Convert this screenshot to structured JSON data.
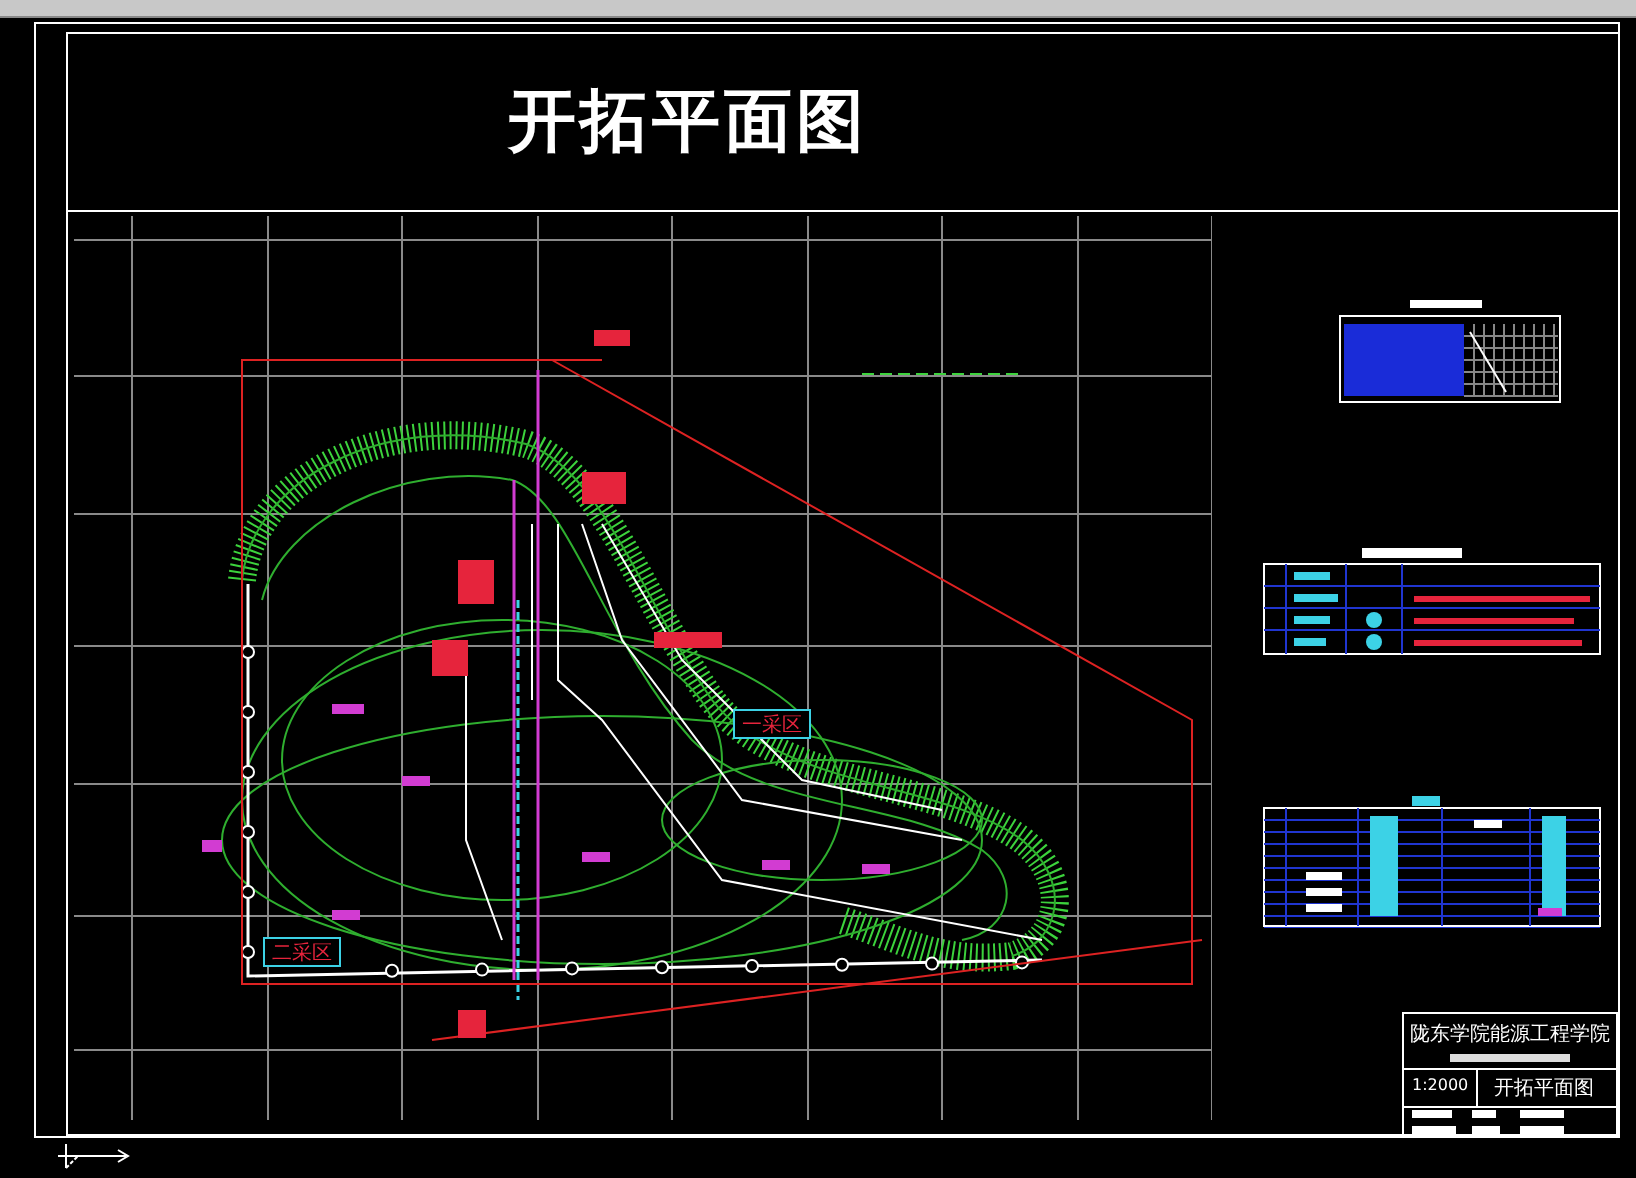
{
  "title": "开拓平面图",
  "plan": {
    "zone_labels": [
      {
        "text": "一采区"
      },
      {
        "text": "二采区"
      }
    ]
  },
  "title_block": {
    "school": "陇东学院能源工程学院",
    "scale": "1:2000",
    "drawing_name": "开拓平面图"
  }
}
